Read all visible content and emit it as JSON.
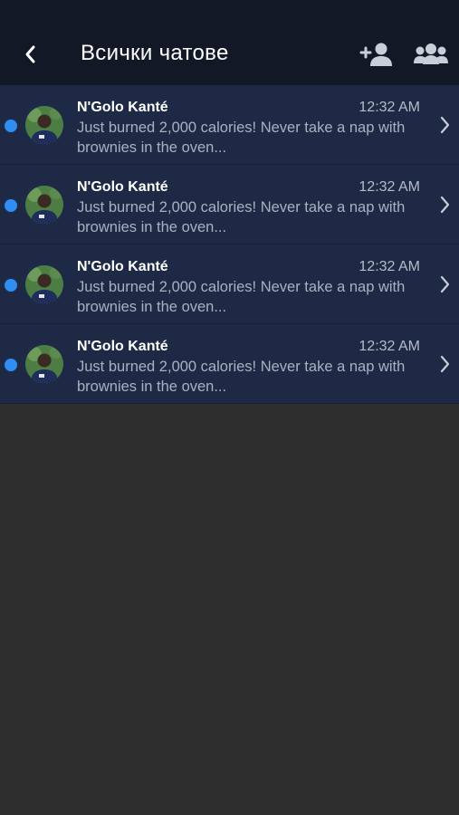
{
  "header": {
    "title": "Всички чатове",
    "back_icon": "chevron-left-icon",
    "add_contact_icon": "user-plus-icon",
    "group_icon": "users-group-icon"
  },
  "colors": {
    "header_bg": "#121826",
    "row_bg": "#1e2a45",
    "unread_dot": "#2f8ef3",
    "page_bg": "#2e2e2e"
  },
  "chats": [
    {
      "name": "N'Golo Kanté",
      "time": "12:32 AM",
      "preview": "Just burned 2,000 calories! Never take a nap with brownies in the oven...",
      "unread": true
    },
    {
      "name": "N'Golo Kanté",
      "time": "12:32 AM",
      "preview": "Just burned 2,000 calories! Never take a nap with brownies in the oven...",
      "unread": true
    },
    {
      "name": "N'Golo Kanté",
      "time": "12:32 AM",
      "preview": "Just burned 2,000 calories! Never take a nap with brownies in the oven...",
      "unread": true
    },
    {
      "name": "N'Golo Kanté",
      "time": "12:32 AM",
      "preview": "Just burned 2,000 calories! Never take a nap with brownies in the oven...",
      "unread": true
    }
  ]
}
